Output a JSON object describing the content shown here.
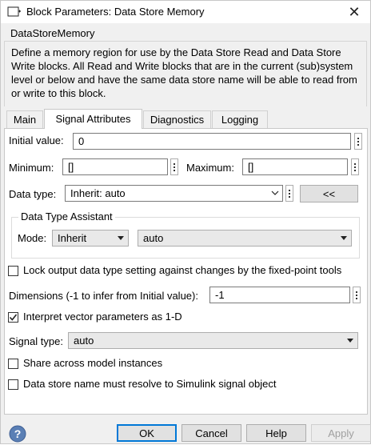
{
  "window": {
    "title": "Block Parameters: Data Store Memory",
    "close_symbol": "✕"
  },
  "block": {
    "name": "DataStoreMemory",
    "description": "Define a memory region for use by the Data Store Read and Data Store Write blocks. All Read and Write blocks that are in the current (sub)system level or below and have the same data store name will be able to read from or write to this block."
  },
  "tabs": [
    {
      "label": "Main",
      "active": false
    },
    {
      "label": "Signal Attributes",
      "active": true
    },
    {
      "label": "Diagnostics",
      "active": false
    },
    {
      "label": "Logging",
      "active": false
    }
  ],
  "signal_attributes": {
    "initial_value": {
      "label": "Initial value:",
      "value": "0"
    },
    "minimum": {
      "label": "Minimum:",
      "value": "[]"
    },
    "maximum": {
      "label": "Maximum:",
      "value": "[]"
    },
    "data_type": {
      "label": "Data type:",
      "value": "Inherit: auto",
      "assistant_toggle": "<<"
    },
    "assistant": {
      "title": "Data Type Assistant",
      "mode_label": "Mode:",
      "mode_value": "Inherit",
      "sub_value": "auto"
    },
    "lock_output": {
      "label": "Lock output data type setting against changes by the fixed-point tools",
      "checked": false
    },
    "dimensions": {
      "label": "Dimensions (-1 to infer from Initial value):",
      "value": "-1"
    },
    "interpret_vector": {
      "label": "Interpret vector parameters as 1-D",
      "checked": true
    },
    "signal_type": {
      "label": "Signal type:",
      "value": "auto"
    },
    "share_instances": {
      "label": "Share across model instances",
      "checked": false
    },
    "resolve_simulink": {
      "label": "Data store name must resolve to Simulink signal object",
      "checked": false
    }
  },
  "footer": {
    "ok": "OK",
    "cancel": "Cancel",
    "help": "Help",
    "apply": "Apply"
  },
  "colors": {
    "accent": "#0078d7",
    "help_icon": "#5a7fb5",
    "window_bg": "#f0f0f0"
  }
}
